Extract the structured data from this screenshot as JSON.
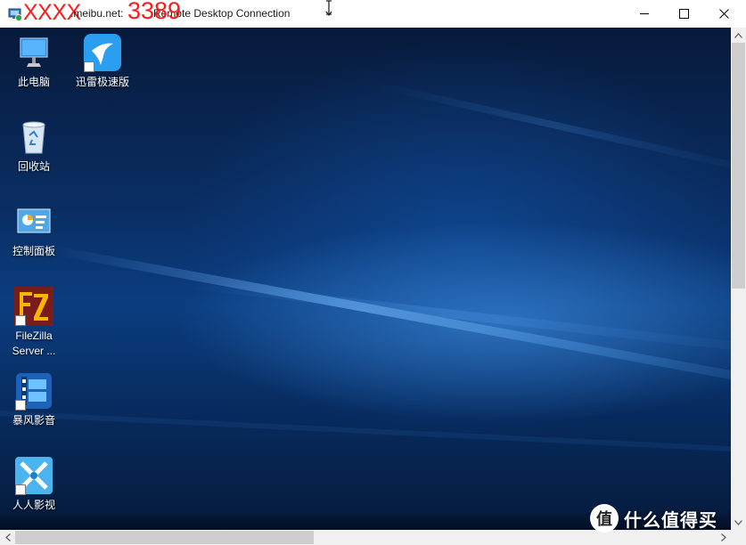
{
  "window": {
    "title_redacted_prefix": "XXXX",
    "title_host": ".meibu.net:",
    "title_port": "3389",
    "title_app": "Remote Desktop Connection"
  },
  "controls": {
    "minimize_icon": "minimize-icon",
    "maximize_icon": "maximize-icon",
    "close_icon": "close-icon"
  },
  "desktop": {
    "icons": [
      {
        "label": "此电脑",
        "icon": "this-pc-icon"
      },
      {
        "label": "迅雷极速版",
        "icon": "thunder-icon"
      },
      {
        "label": "回收站",
        "icon": "recycle-bin-icon"
      },
      {
        "label": "控制面板",
        "icon": "control-panel-icon"
      },
      {
        "label": "FileZilla Server ...",
        "icon": "filezilla-icon"
      },
      {
        "label": "暴风影音",
        "icon": "baofeng-icon"
      },
      {
        "label": "人人影视",
        "icon": "renren-icon"
      }
    ]
  },
  "watermark": {
    "glyph": "值",
    "text": "什么值得买"
  },
  "colors": {
    "accent_red": "#ff1a1a",
    "desktop_blue": "#0b3d80"
  }
}
